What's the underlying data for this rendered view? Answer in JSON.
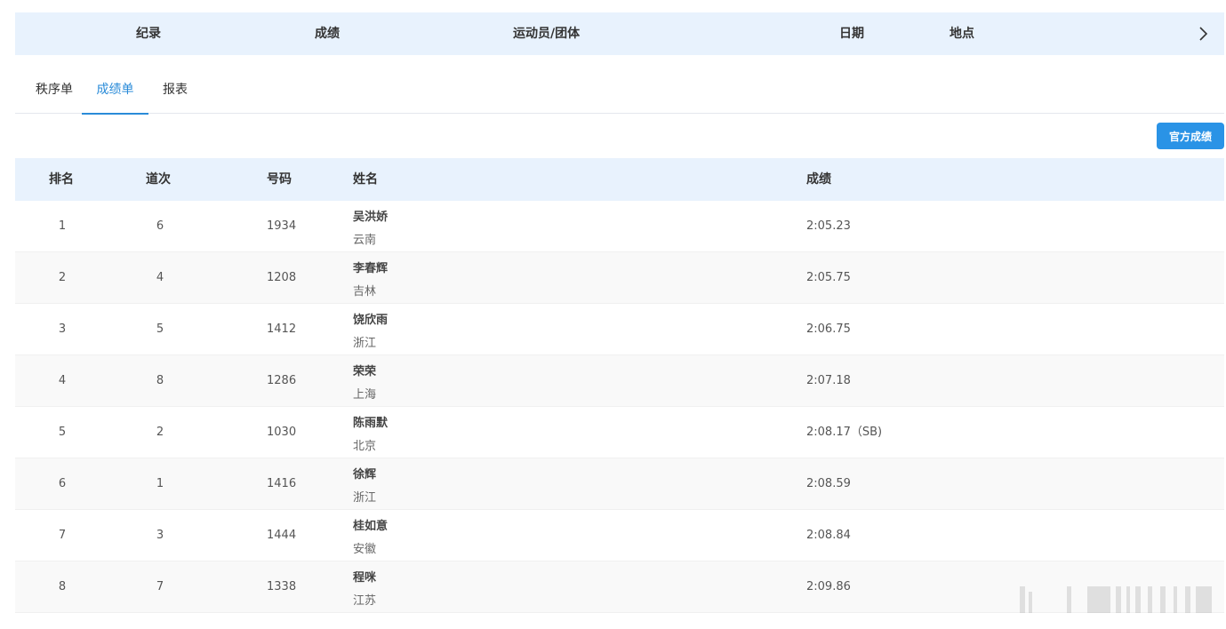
{
  "records_bar": {
    "columns": [
      "纪录",
      "成绩",
      "运动员/团体",
      "日期",
      "地点"
    ]
  },
  "tabs": [
    {
      "label": "秩序单",
      "active": false
    },
    {
      "label": "成绩单",
      "active": true
    },
    {
      "label": "报表",
      "active": false
    }
  ],
  "official_button": "官方成绩",
  "results": {
    "headers": {
      "rank": "排名",
      "lane": "道次",
      "bib": "号码",
      "name": "姓名",
      "result": "成绩"
    },
    "rows": [
      {
        "rank": "1",
        "lane": "6",
        "bib": "1934",
        "name": "吴洪娇",
        "team": "云南",
        "result": "2:05.23"
      },
      {
        "rank": "2",
        "lane": "4",
        "bib": "1208",
        "name": "李春辉",
        "team": "吉林",
        "result": "2:05.75"
      },
      {
        "rank": "3",
        "lane": "5",
        "bib": "1412",
        "name": "饶欣雨",
        "team": "浙江",
        "result": "2:06.75"
      },
      {
        "rank": "4",
        "lane": "8",
        "bib": "1286",
        "name": "荣荣",
        "team": "上海",
        "result": "2:07.18"
      },
      {
        "rank": "5",
        "lane": "2",
        "bib": "1030",
        "name": "陈雨默",
        "team": "北京",
        "result": "2:08.17（SB)"
      },
      {
        "rank": "6",
        "lane": "1",
        "bib": "1416",
        "name": "徐辉",
        "team": "浙江",
        "result": "2:08.59"
      },
      {
        "rank": "7",
        "lane": "3",
        "bib": "1444",
        "name": "桂如意",
        "team": "安徽",
        "result": "2:08.84"
      },
      {
        "rank": "8",
        "lane": "7",
        "bib": "1338",
        "name": "程咪",
        "team": "江苏",
        "result": "2:09.86"
      }
    ]
  },
  "icons": {
    "next": "chevron-right-icon"
  },
  "colors": {
    "accent": "#2a8bd8",
    "header_bg": "#e8f2fd",
    "button_bg": "#2a93e6"
  }
}
